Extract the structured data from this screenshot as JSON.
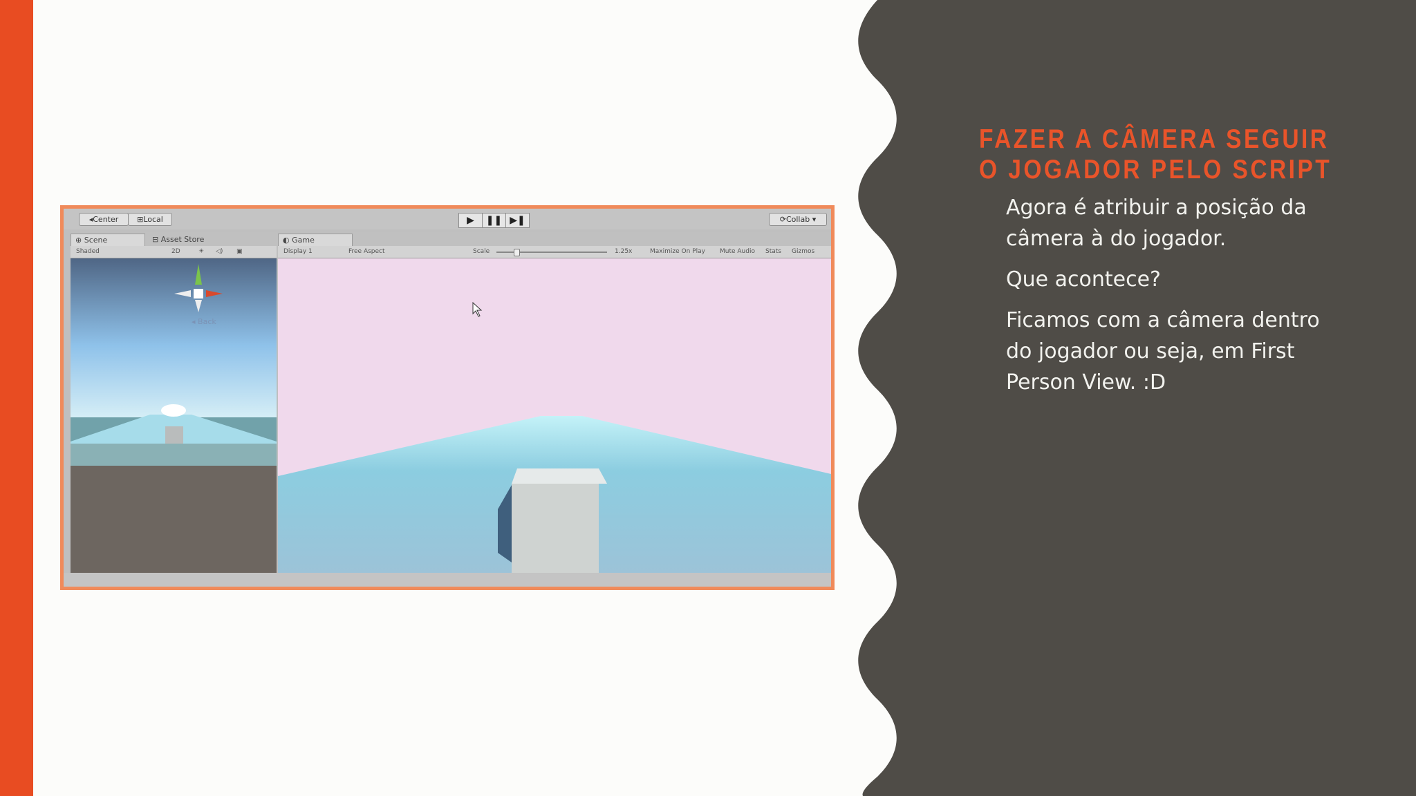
{
  "slide": {
    "title_lines": [
      "FAZER A CÂMERA SEGUIR",
      "O JOGADOR PELO SCRIPT"
    ],
    "paragraphs": [
      "Agora é atribuir a posição da câmera à do jogador.",
      "Que acontece?",
      "Ficamos com a câmera dentro do jogador ou seja, em First Person View. :D"
    ]
  },
  "unity": {
    "toolbar": {
      "center_label": "Center",
      "local_label": "Local",
      "collab_label": "Collab"
    },
    "scene_panel": {
      "tab_scene": "Scene",
      "tab_asset_store": "Asset Store",
      "shading_mode": "Shaded",
      "mode_2d": "2D",
      "gizmo_label": "Back"
    },
    "game_panel": {
      "tab_game": "Game",
      "display": "Display 1",
      "aspect": "Free Aspect",
      "scale_label": "Scale",
      "scale_value": "1.25x",
      "scale_fraction": 0.18,
      "maximize_label": "Maximize On Play",
      "mute_label": "Mute Audio",
      "stats_label": "Stats",
      "gizmos_label": "Gizmos"
    }
  },
  "colors": {
    "accent": "#e84c22",
    "title": "#e9542a",
    "panel_bg": "#4f4c47",
    "sky": "#f0d9ec",
    "ground": "#8fcbe0",
    "cube": "#cdd3d3"
  }
}
